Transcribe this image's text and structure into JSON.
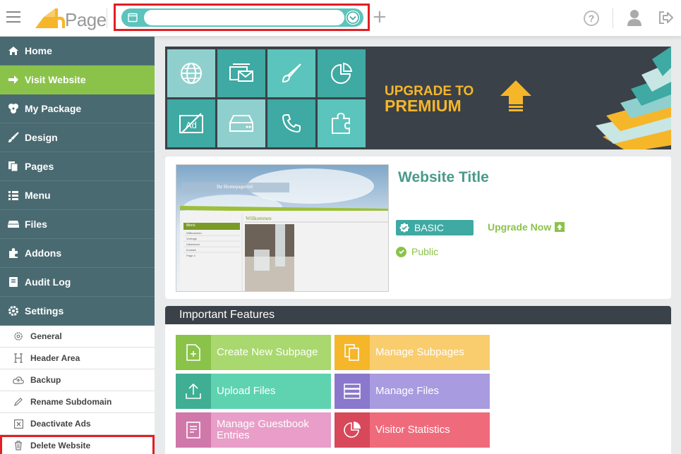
{
  "header": {
    "logo_text": "Page",
    "site_selector_value": "",
    "icons": {
      "menu": "hamburger-icon",
      "add": "plus-icon",
      "help": "question-icon",
      "user": "user-icon",
      "logout": "logout-icon"
    }
  },
  "sidebar": {
    "items": [
      {
        "label": "Home",
        "icon": "home-icon"
      },
      {
        "label": "Visit Website",
        "icon": "arrow-right-icon",
        "active": true
      },
      {
        "label": "My Package",
        "icon": "package-icon"
      },
      {
        "label": "Design",
        "icon": "brush-icon"
      },
      {
        "label": "Pages",
        "icon": "pages-icon"
      },
      {
        "label": "Menu",
        "icon": "menu-list-icon"
      },
      {
        "label": "Files",
        "icon": "drive-icon"
      },
      {
        "label": "Addons",
        "icon": "puzzle-icon"
      },
      {
        "label": "Audit Log",
        "icon": "book-icon"
      },
      {
        "label": "Settings",
        "icon": "gear-icon"
      }
    ],
    "settings_items": [
      {
        "label": "General",
        "icon": "gear-icon"
      },
      {
        "label": "Header Area",
        "icon": "heading-icon"
      },
      {
        "label": "Backup",
        "icon": "cloud-upload-icon"
      },
      {
        "label": "Rename Subdomain",
        "icon": "pencil-icon"
      },
      {
        "label": "Deactivate Ads",
        "icon": "close-box-icon"
      },
      {
        "label": "Delete Website",
        "icon": "trash-icon"
      }
    ]
  },
  "banner": {
    "line1": "UPGRADE TO",
    "line2": "PREMIUM"
  },
  "site": {
    "thumb_header": "Ihr Homepagetitel",
    "thumb_menu": "Menü",
    "thumb_welcome": "Willkommen",
    "thumb_links": [
      "Willkommen",
      "Vorfrage",
      "Gästebuch",
      "Kontakt",
      "Page 4"
    ],
    "title": "Website Title",
    "package": "BASIC",
    "upgrade_label": "Upgrade Now",
    "visibility": "Public"
  },
  "features": {
    "heading": "Important Features",
    "buttons": [
      {
        "label": "Create New Subpage",
        "icon": "new-page-icon",
        "color": "#a9d86e",
        "icon_bg": "#8bc34a"
      },
      {
        "label": "Manage Subpages",
        "icon": "copy-pages-icon",
        "color": "#f9cd6e",
        "icon_bg": "#f5b62a"
      },
      {
        "label": "Upload Files",
        "icon": "upload-icon",
        "color": "#5fd3b0",
        "icon_bg": "#3fae93"
      },
      {
        "label": "Manage Files",
        "icon": "server-icon",
        "color": "#a99be0",
        "icon_bg": "#8a78cc"
      },
      {
        "label": "Manage Guestbook Entries",
        "icon": "guestbook-icon",
        "color": "#e89ec8",
        "icon_bg": "#cf78a9"
      },
      {
        "label": "Visitor Statistics",
        "icon": "pie-chart-icon",
        "color": "#ef6b7c",
        "icon_bg": "#d7485a"
      }
    ]
  },
  "colors": {
    "sidebar_bg": "#4a6a72",
    "active": "#8bc34a",
    "accent_teal": "#3fa9a3",
    "title_green": "#4a9a8a",
    "highlight_red": "#e31e24"
  }
}
